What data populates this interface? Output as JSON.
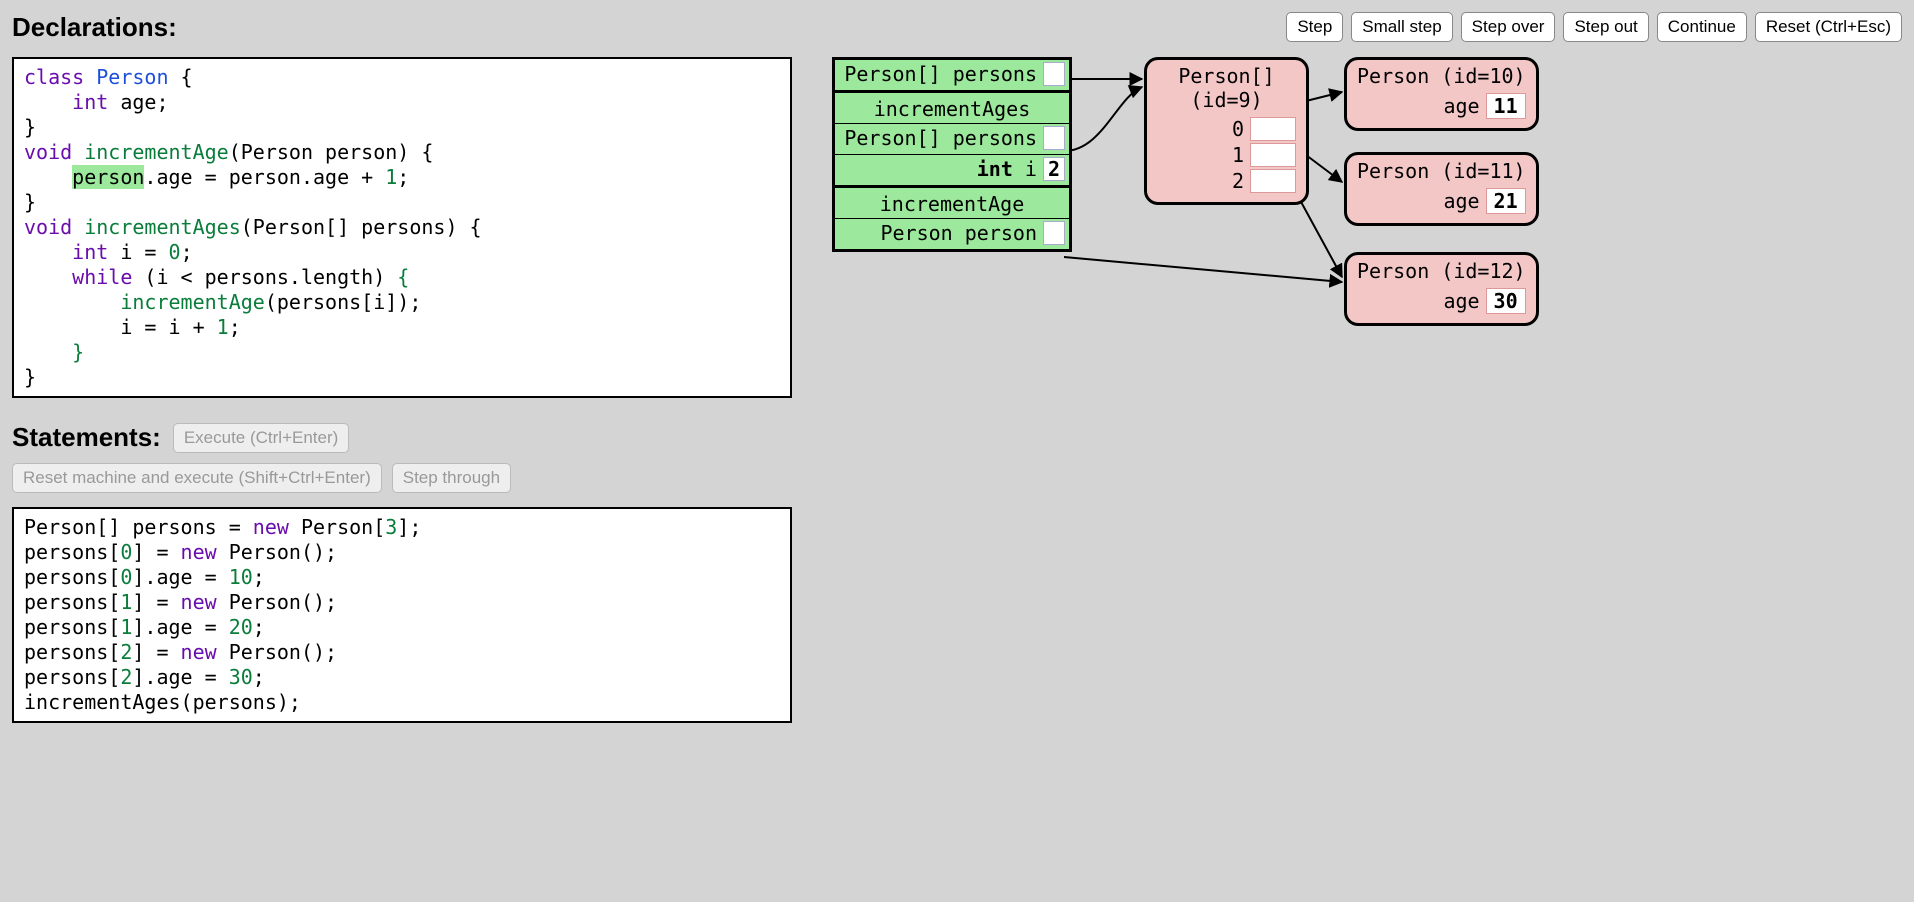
{
  "sections": {
    "declarations_title": "Declarations:",
    "statements_title": "Statements:"
  },
  "toolbar": {
    "step": "Step",
    "small_step": "Small step",
    "step_over": "Step over",
    "step_out": "Step out",
    "continue": "Continue",
    "reset": "Reset (Ctrl+Esc)"
  },
  "stmt_buttons": {
    "execute": "Execute (Ctrl+Enter)",
    "reset_execute": "Reset machine and execute (Shift+Ctrl+Enter)",
    "step_through": "Step through"
  },
  "declarations_code": {
    "l1a": "class",
    "l1b": " Person",
    "l1c": " {",
    "l2a": "    int",
    "l2b": " age;",
    "l3": "}",
    "l4a": "void",
    "l4b": " incrementAge",
    "l4c": "(Person person) {",
    "l5a": "    ",
    "l5hl": "person",
    "l5b": ".age = person.age + ",
    "l5num": "1",
    "l5c": ";",
    "l6": "}",
    "l7a": "void",
    "l7b": " incrementAges",
    "l7c": "(Person[] persons) {",
    "l8a": "    int",
    "l8b": " i = ",
    "l8num": "0",
    "l8c": ";",
    "l9a": "    while",
    "l9b": " (i < persons.length) ",
    "l9brace": "{",
    "l10a": "        incrementAge",
    "l10b": "(persons[i]);",
    "l11a": "        i = i + ",
    "l11num": "1",
    "l11b": ";",
    "l12": "    }",
    "l13": "}"
  },
  "statements_code": {
    "l1a": "Person[] persons = ",
    "l1new": "new",
    "l1b": " Person[",
    "l1n": "3",
    "l1c": "];",
    "l2a": "persons[",
    "l2n": "0",
    "l2b": "] = ",
    "l2new": "new",
    "l2c": " Person();",
    "l3a": "persons[",
    "l3n": "0",
    "l3b": "].age = ",
    "l3v": "10",
    "l3c": ";",
    "l4a": "persons[",
    "l4n": "1",
    "l4b": "] = ",
    "l4new": "new",
    "l4c": " Person();",
    "l5a": "persons[",
    "l5n": "1",
    "l5b": "].age = ",
    "l5v": "20",
    "l5c": ";",
    "l6a": "persons[",
    "l6n": "2",
    "l6b": "] = ",
    "l6new": "new",
    "l6c": " Person();",
    "l7a": "persons[",
    "l7n": "2",
    "l7b": "].age = ",
    "l7v": "30",
    "l7c": ";",
    "l8": "incrementAges(persons);"
  },
  "stack": {
    "f0_label": "Person[] persons",
    "f1_title": "incrementAges",
    "f1_var1_label": "Person[] persons",
    "f1_var2_type": "int",
    "f1_var2_name": " i",
    "f1_var2_value": "2",
    "f2_title": "incrementAge",
    "f2_var1_label": "Person person"
  },
  "heap": {
    "array_title": "Person[] (id=9)",
    "idx0": "0",
    "idx1": "1",
    "idx2": "2",
    "p10_title": "Person (id=10)",
    "p10_field": "age",
    "p10_val": "11",
    "p11_title": "Person (id=11)",
    "p11_field": "age",
    "p11_val": "21",
    "p12_title": "Person (id=12)",
    "p12_field": "age",
    "p12_val": "30"
  }
}
